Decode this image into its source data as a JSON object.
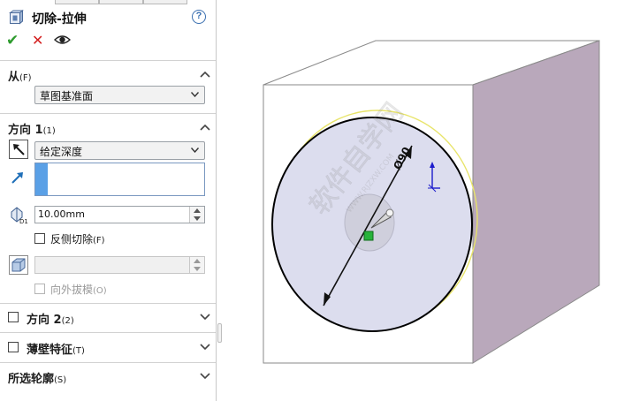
{
  "feature": {
    "title": "切除-拉伸",
    "help_glyph": "?",
    "ok_glyph": "✔",
    "cancel_glyph": "✕"
  },
  "from_section": {
    "title": "从",
    "shortcut": "(F)",
    "selected": "草图基准面"
  },
  "direction1": {
    "title": "方向 1",
    "shortcut": "(1)",
    "end_condition": "给定深度",
    "depth": "10.00mm",
    "flip_side_label": "反侧切除",
    "flip_side_shortcut": "(F)",
    "flip_side_checked": false,
    "draft_value": "",
    "draft_outward_label": "向外拔模",
    "draft_outward_shortcut": "(O)"
  },
  "direction2": {
    "title": "方向 2",
    "shortcut": "(2)",
    "checked": false
  },
  "thin_feature": {
    "title": "薄壁特征",
    "shortcut": "(T)",
    "checked": false
  },
  "selected_contours": {
    "title": "所选轮廓",
    "shortcut": "(S)"
  },
  "viewport": {
    "diameter_label": "Ø90",
    "watermark_text": "软件自学网",
    "watermark_sub": "WWW.RJZXW.COM",
    "colors": {
      "cube_front": "#ffffff",
      "cube_top": "#ffffff",
      "cube_side": "#b9a8bb",
      "circle_fill": "#dcddee",
      "yellow_outline": "#e8e46a",
      "accent_green": "#27b33a",
      "axis_blue": "#1c1ccc"
    }
  }
}
